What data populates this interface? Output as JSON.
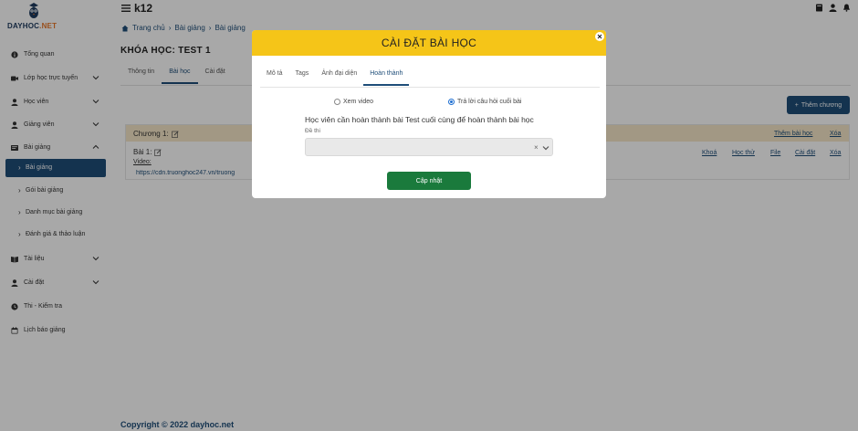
{
  "sidebar": {
    "logo_text_main": "DAYHOC",
    "logo_text_suffix": ".NET",
    "items": [
      {
        "label": "Tổng quan",
        "icon": "info-icon"
      },
      {
        "label": "Lớp học trực tuyến",
        "icon": "video-icon"
      },
      {
        "label": "Học viên",
        "icon": "user-icon"
      },
      {
        "label": "Giảng viên",
        "icon": "user-icon"
      },
      {
        "label": "Bài giảng",
        "icon": "slides-icon"
      },
      {
        "label": "Tài liệu",
        "icon": "book-icon"
      },
      {
        "label": "Cài đặt",
        "icon": "user-icon"
      },
      {
        "label": "Thi - Kiểm tra",
        "icon": "clock-icon"
      },
      {
        "label": "Lịch báo giảng",
        "icon": "calendar-icon"
      }
    ],
    "sub_items": [
      {
        "label": "Bài giảng"
      },
      {
        "label": "Gói bài giảng"
      },
      {
        "label": "Danh mục bài giảng"
      },
      {
        "label": "Đánh giá & thảo luận"
      }
    ]
  },
  "topbar": {
    "title": "k12"
  },
  "breadcrumb": {
    "home": "Trang chủ",
    "level1": "Bài giảng",
    "level2": "Bài giảng"
  },
  "page": {
    "title": "KHÓA HỌC: TEST 1"
  },
  "tabs": [
    {
      "label": "Thông tin"
    },
    {
      "label": "Bài học"
    },
    {
      "label": "Cài đặt"
    }
  ],
  "add_chapter_label": "Thêm chương",
  "chapter": {
    "title": "Chương 1:",
    "add_lesson": "Thêm bài học",
    "delete": "Xóa"
  },
  "lesson": {
    "title": "Bài 1:",
    "video_label": "Video:",
    "url": "https://cdn.truonghoc247.vn/truong",
    "links": {
      "lock": "Khoá",
      "trial": "Học thử",
      "file": "File",
      "settings": "Cài đặt",
      "delete": "Xóa"
    }
  },
  "footer": {
    "text": "Copyright © 2022 dayhoc.net"
  },
  "modal": {
    "title": "CÀI ĐẶT BÀI HỌC",
    "tabs": [
      {
        "label": "Mô tả"
      },
      {
        "label": "Tags"
      },
      {
        "label": "Ảnh đại diện"
      },
      {
        "label": "Hoàn thành"
      }
    ],
    "options": {
      "watch_video": "Xem video",
      "answer_questions": "Trả lời câu hỏi cuối bài",
      "selected": "answer_questions"
    },
    "requirement_text": "Học viên cần hoàn thành bài Test cuối cùng để hoàn thành bài học",
    "exam_label": "Đề thi",
    "exam_value": "",
    "update_button": "Cập nhật"
  },
  "colors": {
    "primary": "#1f4e79",
    "modal_header": "#f5c518",
    "update_button": "#1a7a3c",
    "chapter_header": "#f6e7c8"
  }
}
